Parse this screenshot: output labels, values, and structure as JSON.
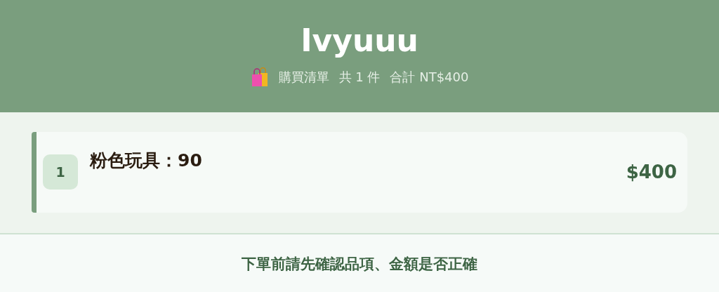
{
  "header": {
    "title": "Ivyuuu",
    "list_label": "購買清單",
    "count": "共 1 件",
    "total": "合計 NT$400"
  },
  "items": [
    {
      "index": "1",
      "name": "粉色玩具：90",
      "price": "$400"
    }
  ],
  "footer": {
    "note": "下單前請先確認品項、金額是否正確"
  }
}
